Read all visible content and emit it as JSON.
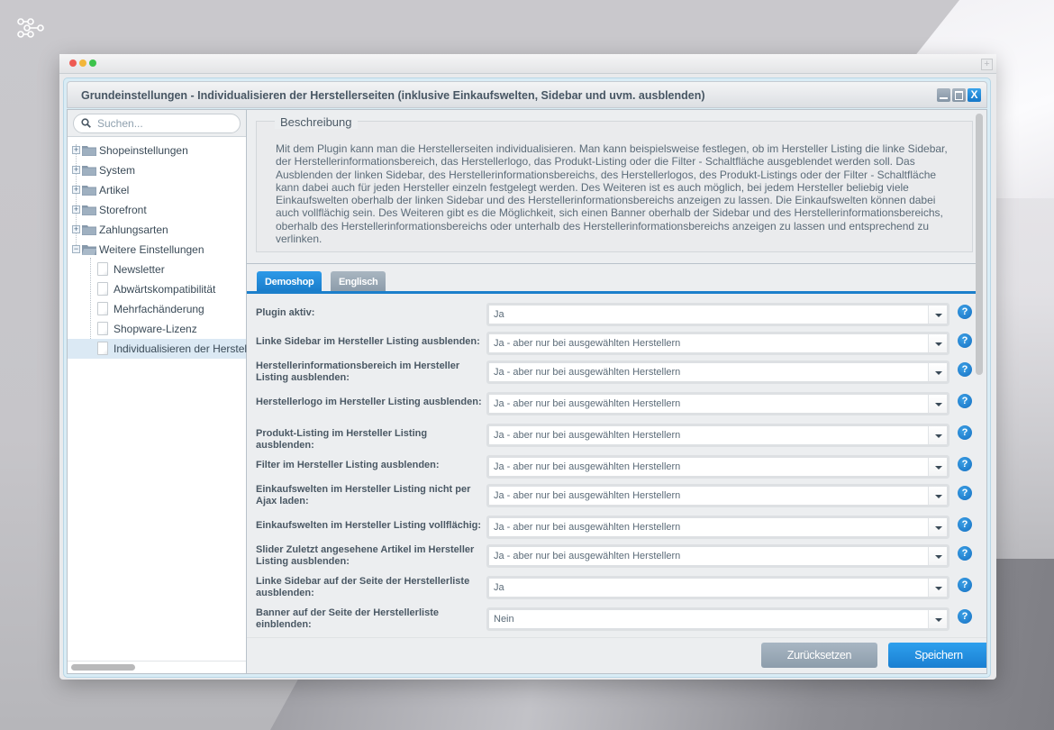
{
  "desktop": {
    "logo_icon": "connected-nodes-icon"
  },
  "window": {
    "title": "Grundeinstellungen - Individualisieren der Herstellerseiten (inklusive Einkaufswelten, Sidebar und uvm. ausblenden)",
    "controls": [
      "minimize",
      "maximize",
      "close"
    ],
    "close_glyph": "X"
  },
  "sidebar": {
    "search": {
      "placeholder": "Suchen...",
      "value": ""
    },
    "tree": [
      {
        "label": "Shopeinstellungen",
        "type": "folder",
        "expanded": false
      },
      {
        "label": "System",
        "type": "folder",
        "expanded": false
      },
      {
        "label": "Artikel",
        "type": "folder",
        "expanded": false
      },
      {
        "label": "Storefront",
        "type": "folder",
        "expanded": false
      },
      {
        "label": "Zahlungsarten",
        "type": "folder",
        "expanded": false
      },
      {
        "label": "Weitere Einstellungen",
        "type": "folder",
        "expanded": true,
        "children": [
          {
            "label": "Newsletter"
          },
          {
            "label": "Abwärtskompatibilität"
          },
          {
            "label": "Mehrfachänderung"
          },
          {
            "label": "Shopware-Lizenz"
          },
          {
            "label": "Individualisieren der Herstellerseiten",
            "selected": true
          }
        ]
      }
    ],
    "expand_glyph": "+",
    "collapse_glyph": "−"
  },
  "description": {
    "legend": "Beschreibung",
    "text": "Mit dem Plugin kann man die Herstellerseiten individualisieren. Man kann beispielsweise festlegen, ob im Hersteller Listing die linke Sidebar, der Herstellerinformationsbereich, das Herstellerlogo, das Produkt-Listing oder die Filter - Schaltfläche ausgeblendet werden soll. Das Ausblenden der linken Sidebar, des Herstellerinformationsbereichs, des Herstellerlogos, des Produkt-Listings oder der Filter - Schaltfläche kann dabei auch für jeden Hersteller einzeln festgelegt werden. Des Weiteren ist es auch möglich, bei jedem Hersteller beliebig viele Einkaufswelten oberhalb der linken Sidebar und des Herstellerinformationsbereichs anzeigen zu lassen. Die Einkaufswelten können dabei auch vollflächig sein. Des Weiteren gibt es die Möglichkeit, sich einen Banner oberhalb der Sidebar und des Herstellerinformationsbereichs, oberhalb des Herstellerinformationsbereichs oder unterhalb des Herstellerinformationsbereichs anzeigen zu lassen und entsprechend zu verlinken."
  },
  "tabs": [
    {
      "label": "Demoshop",
      "active": true
    },
    {
      "label": "Englisch",
      "active": false
    }
  ],
  "form": {
    "help_glyph": "?",
    "fields": [
      {
        "label": "Plugin aktiv:",
        "value": "Ja"
      },
      {
        "label": "Linke Sidebar im Hersteller Listing ausblenden:",
        "value": "Ja - aber nur bei ausgewählten Herstellern"
      },
      {
        "label": "Herstellerinformationsbereich im Hersteller Listing ausblenden:",
        "value": "Ja - aber nur bei ausgewählten Herstellern"
      },
      {
        "label": "Herstellerlogo im Hersteller Listing ausblenden:",
        "value": "Ja - aber nur bei ausgewählten Herstellern"
      },
      {
        "label": "Produkt-Listing im Hersteller Listing ausblenden:",
        "value": "Ja - aber nur bei ausgewählten Herstellern"
      },
      {
        "label": "Filter im Hersteller Listing ausblenden:",
        "value": "Ja - aber nur bei ausgewählten Herstellern"
      },
      {
        "label": "Einkaufswelten im Hersteller Listing nicht per Ajax laden:",
        "value": "Ja - aber nur bei ausgewählten Herstellern"
      },
      {
        "label": "Einkaufswelten im Hersteller Listing vollflächig:",
        "value": "Ja - aber nur bei ausgewählten Herstellern"
      },
      {
        "label": "Slider Zuletzt angesehene Artikel im Hersteller Listing ausblenden:",
        "value": "Ja - aber nur bei ausgewählten Herstellern"
      },
      {
        "label": "Linke Sidebar auf der Seite der Herstellerliste ausblenden:",
        "value": "Ja"
      },
      {
        "label": "Banner auf der Seite der Herstellerliste einblenden:",
        "value": "Nein"
      }
    ]
  },
  "footer": {
    "reset_label": "Zurücksetzen",
    "save_label": "Speichern"
  },
  "colors": {
    "accent": "#1a7fcb",
    "secondary_button": "#9aa9b6",
    "help_icon": "#1a7dcb"
  }
}
